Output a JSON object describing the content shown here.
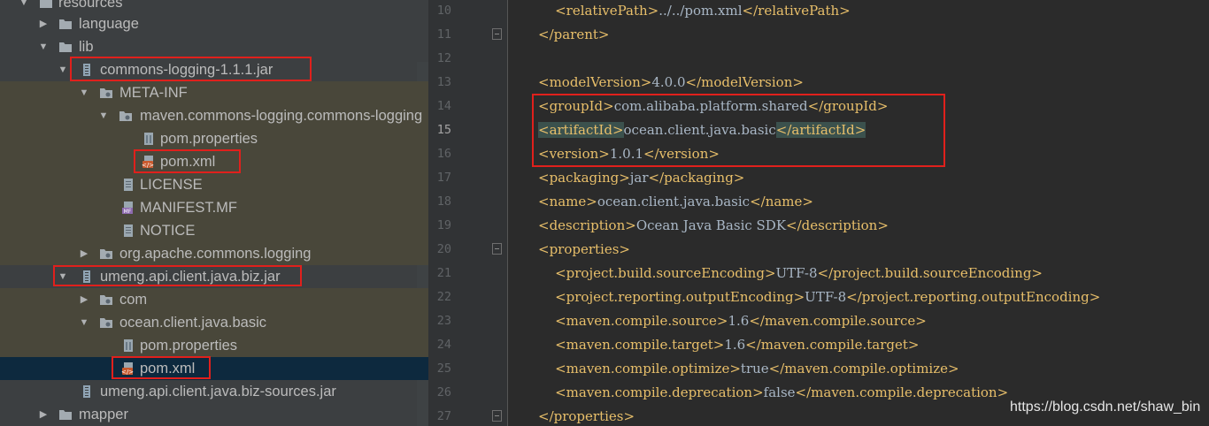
{
  "project_tree": {
    "items": [
      {
        "label": "resources",
        "icon": "folder-icon"
      },
      {
        "label": "language",
        "icon": "folder-icon"
      },
      {
        "label": "lib",
        "icon": "folder-icon"
      },
      {
        "label": "commons-logging-1.1.1.jar",
        "icon": "jar-icon"
      },
      {
        "label": "META-INF",
        "icon": "package-folder-icon"
      },
      {
        "label": "maven.commons-logging.commons-logging",
        "icon": "package-folder-icon"
      },
      {
        "label": "pom.properties",
        "icon": "properties-file-icon"
      },
      {
        "label": "pom.xml",
        "icon": "maven-pom-icon"
      },
      {
        "label": "LICENSE",
        "icon": "text-file-icon"
      },
      {
        "label": "MANIFEST.MF",
        "icon": "manifest-file-icon"
      },
      {
        "label": "NOTICE",
        "icon": "text-file-icon"
      },
      {
        "label": "org.apache.commons.logging",
        "icon": "package-folder-icon"
      },
      {
        "label": "umeng.api.client.java.biz.jar",
        "icon": "jar-icon"
      },
      {
        "label": "com",
        "icon": "package-folder-icon"
      },
      {
        "label": "ocean.client.java.basic",
        "icon": "package-folder-icon"
      },
      {
        "label": "pom.properties",
        "icon": "properties-file-icon"
      },
      {
        "label": "pom.xml",
        "icon": "maven-pom-icon"
      },
      {
        "label": "umeng.api.client.java.biz-sources.jar",
        "icon": "jar-icon"
      },
      {
        "label": "mapper",
        "icon": "folder-icon"
      }
    ],
    "selected_item": "pom.xml"
  },
  "editor": {
    "line_numbers": [
      "10",
      "11",
      "12",
      "13",
      "14",
      "15",
      "16",
      "17",
      "18",
      "19",
      "20",
      "21",
      "22",
      "23",
      "24",
      "25",
      "26",
      "27"
    ],
    "code": [
      {
        "indent": "    ",
        "open": "<relativePath>",
        "value": "../../pom.xml",
        "close": "</relativePath>"
      },
      {
        "indent": "",
        "open": "</parent>",
        "value": "",
        "close": ""
      },
      {
        "indent": "",
        "open": "",
        "value": "",
        "close": ""
      },
      {
        "indent": "",
        "open": "<modelVersion>",
        "value": "4.0.0",
        "close": "</modelVersion>"
      },
      {
        "indent": "",
        "open": "<groupId>",
        "value": "com.alibaba.platform.shared",
        "close": "</groupId>"
      },
      {
        "indent": "",
        "open": "<artifactId>",
        "value": "ocean.client.java.basic",
        "close": "</artifactId>"
      },
      {
        "indent": "",
        "open": "<version>",
        "value": "1.0.1",
        "close": "</version>"
      },
      {
        "indent": "",
        "open": "<packaging>",
        "value": "jar",
        "close": "</packaging>"
      },
      {
        "indent": "",
        "open": "<name>",
        "value": "ocean.client.java.basic",
        "close": "</name>"
      },
      {
        "indent": "",
        "open": "<description>",
        "value": "Ocean Java Basic SDK",
        "close": "</description>"
      },
      {
        "indent": "",
        "open": "<properties>",
        "value": "",
        "close": ""
      },
      {
        "indent": "    ",
        "open": "<project.build.sourceEncoding>",
        "value": "UTF-8",
        "close": "</project.build.sourceEncoding>"
      },
      {
        "indent": "    ",
        "open": "<project.reporting.outputEncoding>",
        "value": "UTF-8",
        "close": "</project.reporting.outputEncoding>"
      },
      {
        "indent": "    ",
        "open": "<maven.compile.source>",
        "value": "1.6",
        "close": "</maven.compile.source>"
      },
      {
        "indent": "    ",
        "open": "<maven.compile.target>",
        "value": "1.6",
        "close": "</maven.compile.target>"
      },
      {
        "indent": "    ",
        "open": "<maven.compile.optimize>",
        "value": "true",
        "close": "</maven.compile.optimize>"
      },
      {
        "indent": "    ",
        "open": "<maven.compile.deprecation>",
        "value": "false",
        "close": "</maven.compile.deprecation>"
      },
      {
        "indent": "",
        "open": "</properties>",
        "value": "",
        "close": ""
      }
    ],
    "caret_line": "15"
  },
  "watermark": "https://blog.csdn.net/shaw_bin",
  "colors": {
    "tree_bg": "#3c3f41",
    "editor_bg": "#2b2b2b",
    "xml_tag": "#e8bf6a",
    "text": "#a9b7c6",
    "selection": "#0d293e",
    "jar_highlight_bg": "#49473a",
    "annotation_red": "#e0201c"
  }
}
